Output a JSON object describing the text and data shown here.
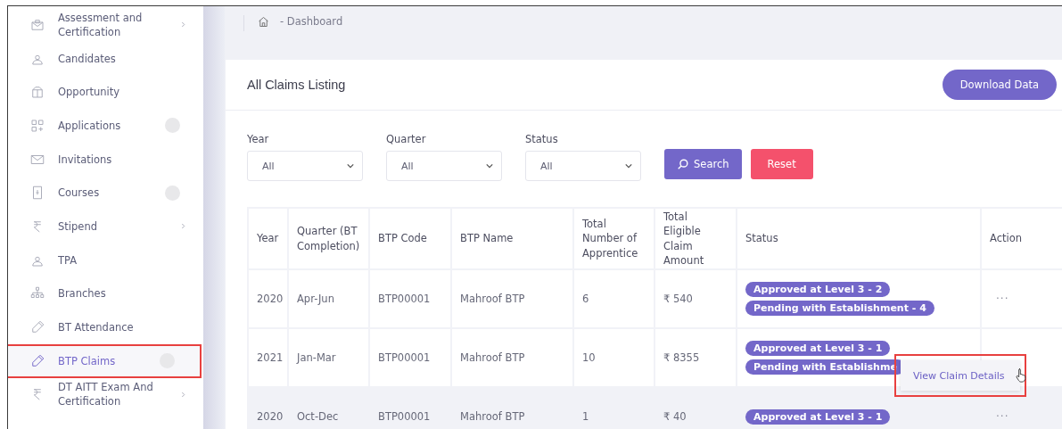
{
  "sidebar": {
    "items": [
      {
        "label": "Assessment and Certification",
        "selected": false,
        "has_submenu": true,
        "has_badge": false,
        "highlighted": false
      },
      {
        "label": "Candidates",
        "selected": false,
        "has_submenu": false,
        "has_badge": false,
        "highlighted": false
      },
      {
        "label": "Opportunity",
        "selected": false,
        "has_submenu": false,
        "has_badge": false,
        "highlighted": false
      },
      {
        "label": "Applications",
        "selected": false,
        "has_submenu": false,
        "has_badge": true,
        "highlighted": false
      },
      {
        "label": "Invitations",
        "selected": false,
        "has_submenu": false,
        "has_badge": false,
        "highlighted": false
      },
      {
        "label": "Courses",
        "selected": false,
        "has_submenu": false,
        "has_badge": true,
        "highlighted": false
      },
      {
        "label": "Stipend",
        "selected": false,
        "has_submenu": true,
        "has_badge": false,
        "highlighted": false
      },
      {
        "label": "TPA",
        "selected": false,
        "has_submenu": false,
        "has_badge": false,
        "highlighted": false
      },
      {
        "label": "Branches",
        "selected": false,
        "has_submenu": false,
        "has_badge": false,
        "highlighted": false
      },
      {
        "label": "BT Attendance",
        "selected": false,
        "has_submenu": false,
        "has_badge": false,
        "highlighted": false
      },
      {
        "label": "BTP Claims",
        "selected": true,
        "has_submenu": false,
        "has_badge": true,
        "highlighted": true
      },
      {
        "label": "DT AITT Exam And Certification",
        "selected": false,
        "has_submenu": true,
        "has_badge": false,
        "highlighted": false
      }
    ]
  },
  "breadcrumb": {
    "text": "- Dashboard"
  },
  "card": {
    "title": "All Claims Listing",
    "download_button": "Download Data",
    "filters": [
      {
        "label": "Year",
        "value": "All"
      },
      {
        "label": "Quarter",
        "value": "All"
      },
      {
        "label": "Status",
        "value": "All"
      }
    ],
    "search_button": "Search",
    "reset_button": "Reset"
  },
  "table": {
    "columns": [
      "Year",
      "Quarter (BT Completion)",
      "BTP Code",
      "BTP Name",
      "Total Number of Apprentice",
      "Total Eligible Claim Amount",
      "Status",
      "Action"
    ],
    "rows": [
      {
        "year": "2020",
        "quarter": "Apr-Jun",
        "btp_code": "BTP00001",
        "btp_name": "Mahroof BTP",
        "apprentices": "6",
        "amount": "₹ 540",
        "statuses": [
          "Approved at Level 3 - 2",
          "Pending with Establishment - 4"
        ],
        "action": "···",
        "hovered": false
      },
      {
        "year": "2021",
        "quarter": "Jan-Mar",
        "btp_code": "BTP00001",
        "btp_name": "Mahroof BTP",
        "apprentices": "10",
        "amount": "₹ 8355",
        "statuses": [
          "Approved at Level 3 - 1",
          "Pending with Establishme"
        ],
        "menu": {
          "item": "View Claim Details",
          "highlighted": true
        },
        "hovered": false
      },
      {
        "year": "2020",
        "quarter": "Oct-Dec",
        "btp_code": "BTP00001",
        "btp_name": "Mahroof BTP",
        "apprentices": "1",
        "amount": "₹ 40",
        "statuses": [
          "Approved at Level 3 - 1"
        ],
        "action": "···",
        "hovered": true
      }
    ]
  }
}
